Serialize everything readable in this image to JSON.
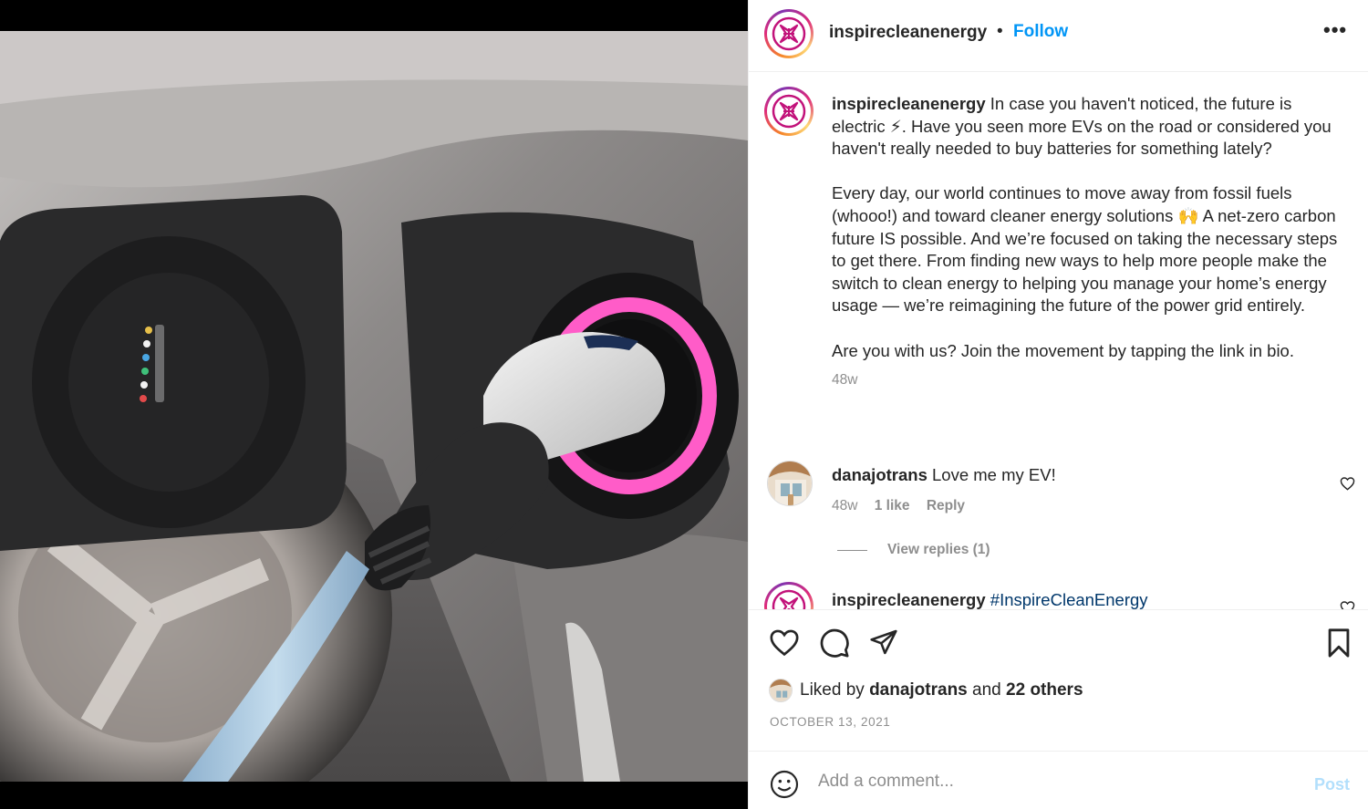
{
  "post": {
    "author": "inspirecleanenergy",
    "follow_label": "Follow",
    "separator": "•",
    "more_label": "•••",
    "caption": {
      "paragraph1": "In case you haven't noticed, the future is electric ⚡. Have you seen more EVs on the road or considered you haven't really needed to buy batteries for something lately?",
      "paragraph2": "Every day, our world continues to move away from fossil fuels (whooo!) and toward cleaner energy solutions 🙌 A net-zero carbon future IS possible. And we’re focused on taking the necessary steps to get there. From finding new ways to help more people make the switch to clean energy to helping you manage your home’s energy usage — we’re reimagining the future of the power grid entirely.",
      "paragraph3": "Are you with us? Join the movement by tapping the link in bio.",
      "time": "48w"
    },
    "comments": [
      {
        "user": "danajotrans",
        "text": "Love me my EV!",
        "time": "48w",
        "likes": "1 like",
        "reply_label": "Reply",
        "view_replies": "View replies (1)"
      },
      {
        "user": "inspirecleanenergy",
        "text": "#InspireCleanEnergy"
      }
    ],
    "liked_by": {
      "prefix": "Liked by",
      "user": "danajotrans",
      "conjunction": "and",
      "others": "22 others"
    },
    "date": "OCTOBER 13, 2021",
    "add_comment": {
      "placeholder": "Add a comment...",
      "post_label": "Post"
    }
  },
  "icons": {
    "like": "heart-icon",
    "comment": "comment-icon",
    "share": "paper-plane-icon",
    "save": "bookmark-icon",
    "emoji": "emoji-icon",
    "more": "more-dots-icon"
  },
  "colors": {
    "link_blue": "#0095f6",
    "hashtag": "#00376b",
    "secondary_text": "#8e8e8e",
    "post_disabled": "#b2dffc",
    "brand_magenta": "#c2127a"
  }
}
